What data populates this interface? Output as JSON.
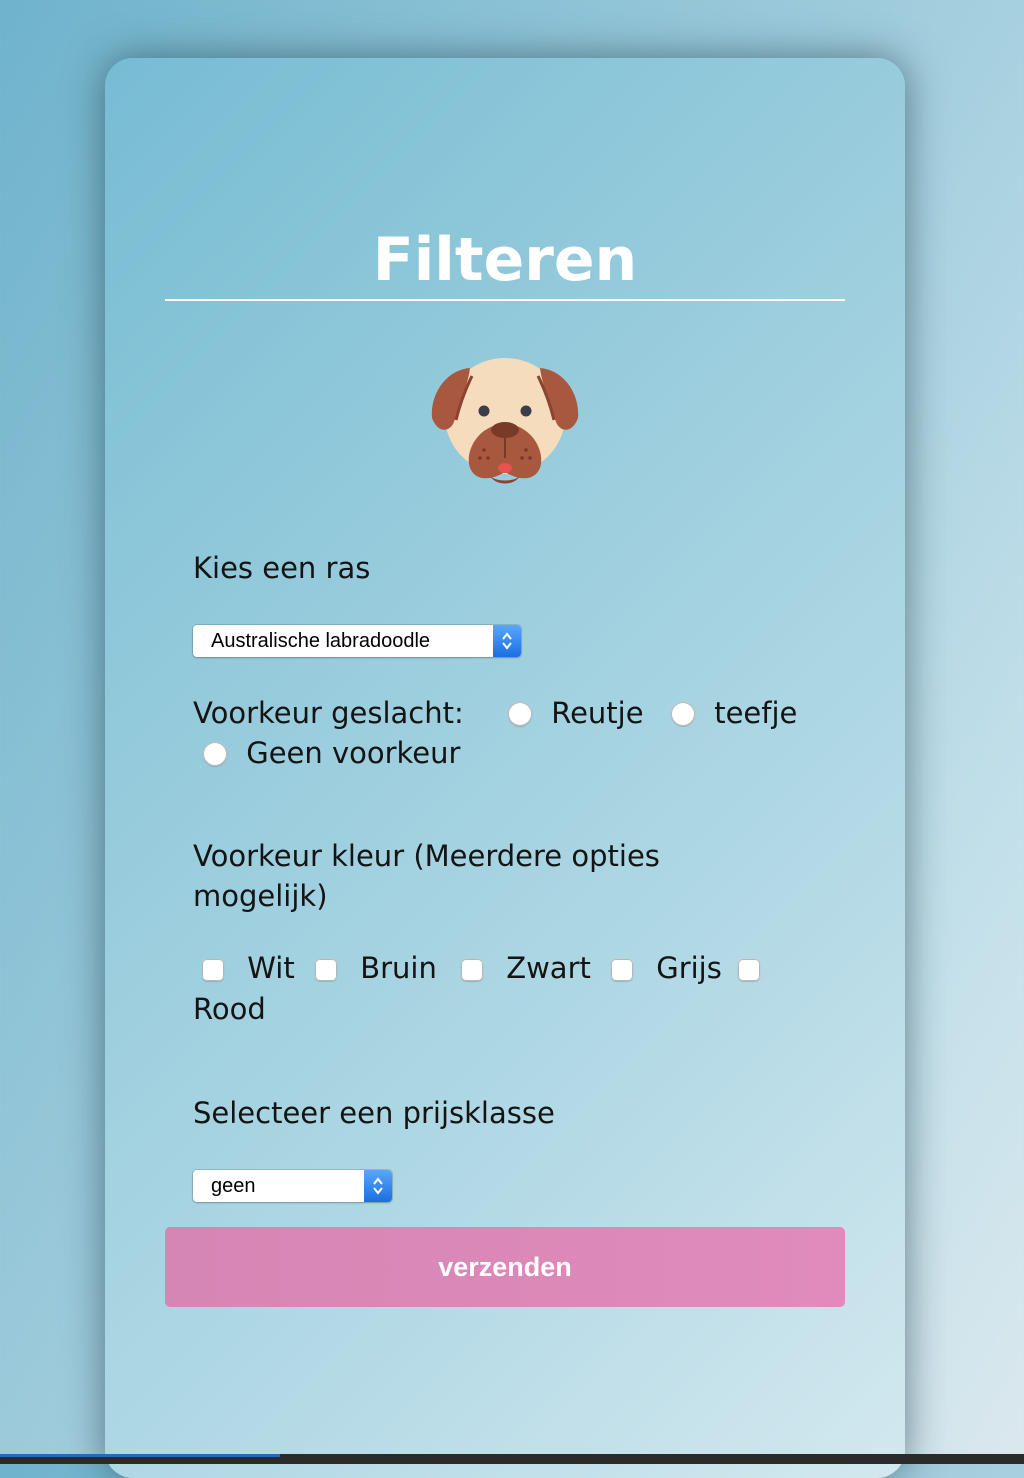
{
  "title": "Filteren",
  "icons": {
    "dog": "dog-face-icon"
  },
  "breed": {
    "label": "Kies een ras",
    "selected": "Australische labradoodle"
  },
  "gender": {
    "label": "Voorkeur geslacht:",
    "options": [
      "Reutje",
      "teefje",
      "Geen voorkeur"
    ]
  },
  "color": {
    "label_line1": "Voorkeur kleur (Meerdere opties",
    "label_line2": "mogelijk)",
    "options": [
      "Wit",
      "Bruin",
      "Zwart",
      "Grijs",
      "Rood"
    ]
  },
  "price": {
    "label": "Selecteer een prijsklasse",
    "selected": "geen"
  },
  "submit_label": "verzenden",
  "colors": {
    "submit": "#dd8ab9",
    "title": "#ffffff",
    "card_start": "#77bcd3",
    "card_end": "#d3e8ef"
  }
}
